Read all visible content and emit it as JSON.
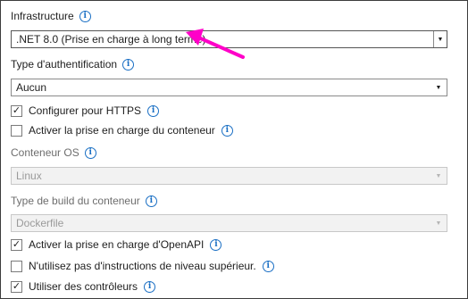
{
  "framework": {
    "label": "Infrastructure",
    "value": ".NET 8.0 (Prise en charge à long terme)"
  },
  "auth": {
    "label": "Type d'authentification",
    "value": "Aucun"
  },
  "https": {
    "label": "Configurer pour HTTPS",
    "checked": true
  },
  "container_support": {
    "label": "Activer la prise en charge du conteneur",
    "checked": false
  },
  "container_os": {
    "label": "Conteneur OS",
    "value": "Linux",
    "disabled": true
  },
  "container_build": {
    "label": "Type de build du conteneur",
    "value": "Dockerfile",
    "disabled": true
  },
  "openapi": {
    "label": "Activer la prise en charge d'OpenAPI",
    "checked": true
  },
  "top_level": {
    "label": "N'utilisez pas d'instructions de niveau supérieur.",
    "checked": false
  },
  "controllers": {
    "label": "Utiliser des contrôleurs",
    "checked": true
  },
  "icons": {
    "info": "info-circle-icon",
    "dropdown": "chevron-down-icon",
    "checkmark": "checkmark-icon",
    "annotation": "pink-arrow-icon"
  },
  "colors": {
    "info_blue": "#1a6fc4",
    "annotation_arrow": "#ff00c8",
    "disabled_text": "#9a9a9a"
  }
}
